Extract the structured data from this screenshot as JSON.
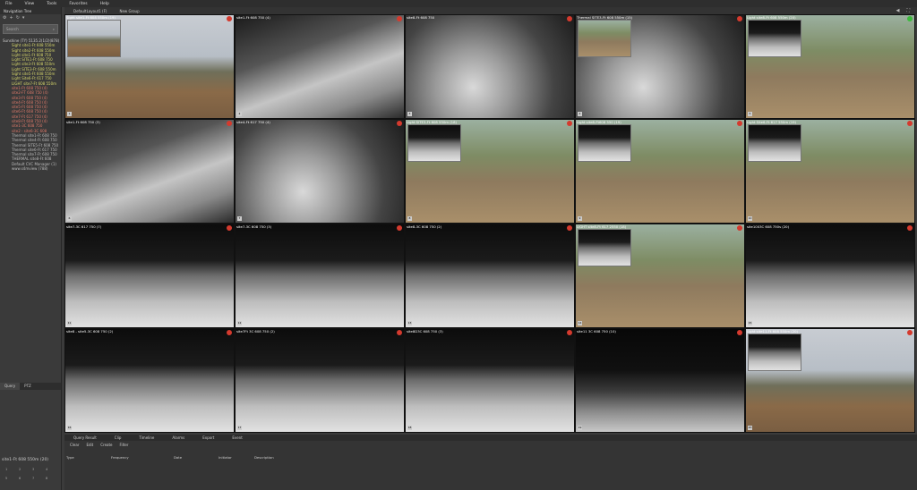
{
  "menu": [
    "File",
    "View",
    "Tools",
    "Favorites",
    "Help"
  ],
  "left_panel": {
    "title": "Navigation Tree",
    "search_placeholder": "Search",
    "tree_root": "Sunshine (TY) 5135.2(1/2)(878)",
    "tree_items": [
      {
        "label": "Sight site1-Ft 608 550m",
        "tone": "yl"
      },
      {
        "label": "Sight site2-Ft 608 550m",
        "tone": "yl"
      },
      {
        "label": "Light site1-Ft 608 750",
        "tone": "yl"
      },
      {
        "label": "Light SITE1-Ft 608 750",
        "tone": "yl"
      },
      {
        "label": "Light site3-Ft 608 550m",
        "tone": "yl"
      },
      {
        "label": "Light SITE3-Ft 608 550m",
        "tone": "yl"
      },
      {
        "label": "Sight site5-Ft 608 550m",
        "tone": "yl"
      },
      {
        "label": "Light Site6-Ft 617 750",
        "tone": "yl"
      },
      {
        "label": "LIGHT site7-Ft 608 550m",
        "tone": "yl"
      },
      {
        "label": "site1-Ft 608 750 (4)",
        "tone": "rd"
      },
      {
        "label": "site2-FT 608 750 (4)",
        "tone": "rd"
      },
      {
        "label": "site3-Ft 608 750 (4)",
        "tone": "rd"
      },
      {
        "label": "site4-Ft 608 750 (4)",
        "tone": "rd"
      },
      {
        "label": "site5-Ft 608 750 (4)",
        "tone": "rd"
      },
      {
        "label": "site6-Ft 608 750 (4)",
        "tone": "rd"
      },
      {
        "label": "site7-Ft 617 750 (4)",
        "tone": "rd"
      },
      {
        "label": "site8-Ft 608 750 (4)",
        "tone": "rd"
      },
      {
        "label": "site1-3C 608 750",
        "tone": "rd"
      },
      {
        "label": "site2 - site6-3C 608",
        "tone": "rd"
      },
      {
        "label": "Thermal site1-Ft 608 750",
        "tone": "gr"
      },
      {
        "label": "Thermal site4-Ft 608 750",
        "tone": "gr"
      },
      {
        "label": "Thermal SITE5-Ft 608 750",
        "tone": "gr"
      },
      {
        "label": "Thermal site6-Ft 617 750",
        "tone": "gr"
      },
      {
        "label": "Thermal site7-Ft 608 750",
        "tone": "gr"
      },
      {
        "label": "THERMAL site8-Ft 608",
        "tone": "gr"
      },
      {
        "label": "Default CVC Manager (1)",
        "tone": "gr"
      },
      {
        "label": "www.s4mview (788)",
        "tone": "gr"
      }
    ],
    "tabs": [
      "Query",
      "PTZ"
    ],
    "status": "site1-Ft 608 550m (20)",
    "preset_numbers": [
      "1",
      "2",
      "3",
      "4",
      "5",
      "6",
      "7",
      "8"
    ]
  },
  "top_tabs": [
    "DefaultLayout1 (F)",
    "New Group"
  ],
  "tiles": [
    {
      "cap": "Sight site1-Ft 608 550m (19)",
      "style": "sky",
      "pip": "sky",
      "num": "1",
      "ok": false
    },
    {
      "cap": "site1-Ft 608 750 (4)",
      "style": "therm2",
      "pip": "",
      "num": "2",
      "ok": false
    },
    {
      "cap": "site8-Ft 608 750",
      "style": "therm",
      "pip": "",
      "num": "3",
      "ok": false
    },
    {
      "cap": "Thermal SITE3-Ft 608 550m (15)",
      "style": "therm",
      "pip": "color1",
      "num": "4",
      "ok": false
    },
    {
      "cap": "Light site8-Ft 608 550m (20)",
      "style": "color1",
      "pip": "therm3",
      "num": "5",
      "ok": true
    },
    {
      "cap": "site1-Ft 608 750 (3)",
      "style": "therm2",
      "pip": "",
      "num": "6",
      "ok": false
    },
    {
      "cap": "site4-Ft 617 750 (4)",
      "style": "therm",
      "pip": "",
      "num": "7",
      "ok": false
    },
    {
      "cap": "Light SITE3-Ft 608 550m (18)",
      "style": "color1",
      "pip": "therm3",
      "num": "8",
      "ok": false
    },
    {
      "cap": "Light site8-Ft608 550 (19)",
      "style": "color1",
      "pip": "therm3",
      "num": "9",
      "ok": false
    },
    {
      "cap": "Light Site6-Ft 617 550m (19)",
      "style": "color1",
      "pip": "therm3",
      "num": "10",
      "ok": false
    },
    {
      "cap": "site7-3C 617 750 (7)",
      "style": "therm3",
      "pip": "",
      "num": "11",
      "ok": false
    },
    {
      "cap": "site7-3C 608 750 (3)",
      "style": "therm3",
      "pip": "",
      "num": "12",
      "ok": false
    },
    {
      "cap": "site8-3C 608 750 (2)",
      "style": "therm3",
      "pip": "",
      "num": "13",
      "ok": false
    },
    {
      "cap": "LIGHT site8-Ft 617 2550 (18)",
      "style": "color1",
      "pip": "therm3",
      "num": "14",
      "ok": false
    },
    {
      "cap": "site1003C 608 750s (20)",
      "style": "therm3",
      "pip": "",
      "num": "15",
      "ok": false
    },
    {
      "cap": "site8 - site5-3C 608 750 (2)",
      "style": "therm3",
      "pip": "",
      "num": "16",
      "ok": false
    },
    {
      "cap": "site7Ft 3C 608 750 (2)",
      "style": "therm3",
      "pip": "",
      "num": "17",
      "ok": false
    },
    {
      "cap": "site8D3C 608 750 (3)",
      "style": "therm3",
      "pip": "",
      "num": "18",
      "ok": false
    },
    {
      "cap": "site11 3C 608 750 (10)",
      "style": "dark",
      "pip": "",
      "num": "19",
      "ok": false
    },
    {
      "cap": "Light site11-Ft 608 550m (20)",
      "style": "sky",
      "pip": "therm3",
      "num": "20",
      "ok": false
    }
  ],
  "bottom": {
    "tabs": [
      "Query Result",
      "Clip",
      "Timeline",
      "Alarms",
      "Export",
      "Event"
    ],
    "tools": [
      "Clear",
      "Edit",
      "Create",
      "Filter"
    ],
    "columns": [
      "Type",
      "Frequency",
      "Date",
      "Initiator",
      "Description"
    ]
  }
}
